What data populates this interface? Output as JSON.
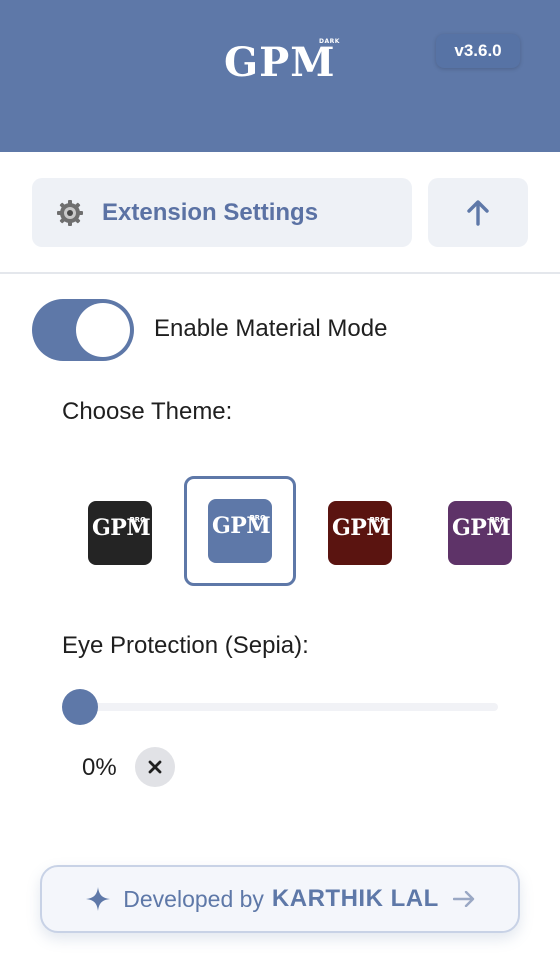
{
  "header": {
    "logo_text": "GPM",
    "logo_badge": "DARK",
    "version": "v3.6.0"
  },
  "toolbar": {
    "settings_label": "Extension Settings",
    "settings_icon": "gear-icon",
    "up_icon": "arrow-up-icon"
  },
  "material_mode": {
    "label": "Enable Material Mode",
    "enabled": true
  },
  "themes": {
    "label": "Choose Theme:",
    "items": [
      {
        "name": "dark",
        "text": "GPM",
        "badge": "PRO",
        "color": "#242424",
        "selected": false
      },
      {
        "name": "blue",
        "text": "GPM",
        "badge": "PRO",
        "color": "#5e78a8",
        "selected": true
      },
      {
        "name": "red",
        "text": "GPM",
        "badge": "PRO",
        "color": "#5a1410",
        "selected": false
      },
      {
        "name": "purple",
        "text": "GPM",
        "badge": "PRO",
        "color": "#5e3368",
        "selected": false
      }
    ]
  },
  "sepia": {
    "label": "Eye Protection (Sepia):",
    "value": 0,
    "value_text": "0%",
    "reset_icon": "close-icon"
  },
  "footer": {
    "prefix": "Developed by",
    "name": "KARTHIK LAL",
    "sparkle_icon": "sparkle-icon",
    "arrow_icon": "arrow-right-icon"
  },
  "colors": {
    "accent": "#5e78a8",
    "button_bg": "#eef1f6"
  }
}
